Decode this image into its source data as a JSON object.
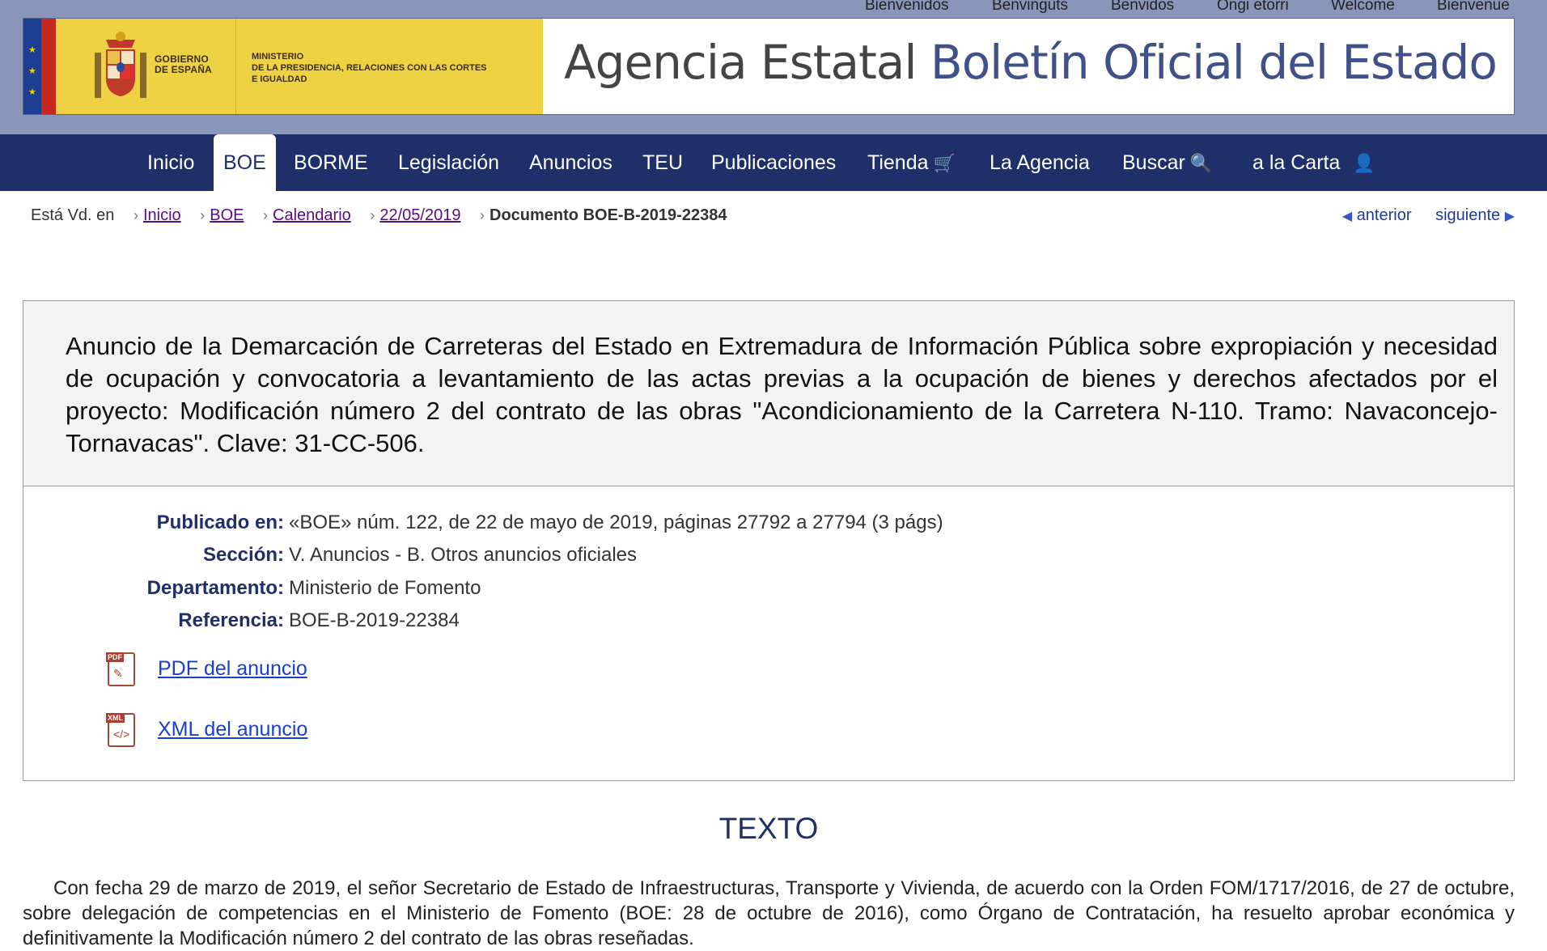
{
  "languages": [
    "Bienvenidos",
    "Benvinguts",
    "Benvidos",
    "Ongi etorri",
    "Welcome",
    "Bienvenue"
  ],
  "header": {
    "gov_line1": "GOBIERNO",
    "gov_line2": "DE ESPAÑA",
    "ministry": "MINISTERIO\nDE LA PRESIDENCIA, RELACIONES CON LAS CORTES\nE IGUALDAD",
    "title_part1": "Agencia Estatal",
    "title_part2": "Boletín Oficial del Estado"
  },
  "nav": {
    "items": [
      {
        "label": "Inicio"
      },
      {
        "label": "BOE"
      },
      {
        "label": "BORME"
      },
      {
        "label": "Legislación"
      },
      {
        "label": "Anuncios"
      },
      {
        "label": "TEU"
      },
      {
        "label": "Publicaciones"
      },
      {
        "label": "Tienda"
      },
      {
        "label": "La Agencia"
      },
      {
        "label": "Buscar"
      },
      {
        "label": "a la Carta"
      }
    ],
    "active": "BOE"
  },
  "breadcrumb": {
    "prefix": "Está Vd. en",
    "links": [
      "Inicio",
      "BOE",
      "Calendario",
      "22/05/2019"
    ],
    "current": "Documento BOE-B-2019-22384"
  },
  "pager": {
    "prev": "anterior",
    "next": "siguiente"
  },
  "document": {
    "title": "Anuncio de la Demarcación de Carreteras del Estado en Extremadura de Información Pública sobre expropiación y necesidad de ocupación y convocatoria a levantamiento de las actas previas a la ocupación de bienes y derechos afectados por el proyecto: Modificación número 2 del contrato de las obras \"Acondicionamiento de la Carretera N-110. Tramo: Navaconcejo-Tornavacas\". Clave: 31-CC-506.",
    "meta": [
      {
        "key": "Publicado en:",
        "value": "«BOE» núm. 122, de 22 de mayo de 2019, páginas 27792 a 27794 (3 págs)"
      },
      {
        "key": "Sección:",
        "value": "V. Anuncios - B. Otros anuncios oficiales"
      },
      {
        "key": "Departamento:",
        "value": "Ministerio de Fomento"
      },
      {
        "key": "Referencia:",
        "value": "BOE-B-2019-22384"
      }
    ],
    "pdf_label": "PDF del anuncio",
    "xml_label": "XML del anuncio",
    "pdf_badge": "PDF",
    "xml_badge": "XML"
  },
  "texto": {
    "heading": "TEXTO",
    "paragraph": "Con fecha 29 de marzo de 2019, el señor Secretario de Estado de Infraestructuras, Transporte y Vivienda, de acuerdo con la Orden FOM/1717/2016, de 27 de octubre, sobre delegación de competencias en el Ministerio de Fomento (BOE: 28 de octubre de 2016), como Órgano de Contratación, ha resuelto aprobar económica y definitivamente la Modificación número 2 del contrato de las obras reseñadas."
  }
}
